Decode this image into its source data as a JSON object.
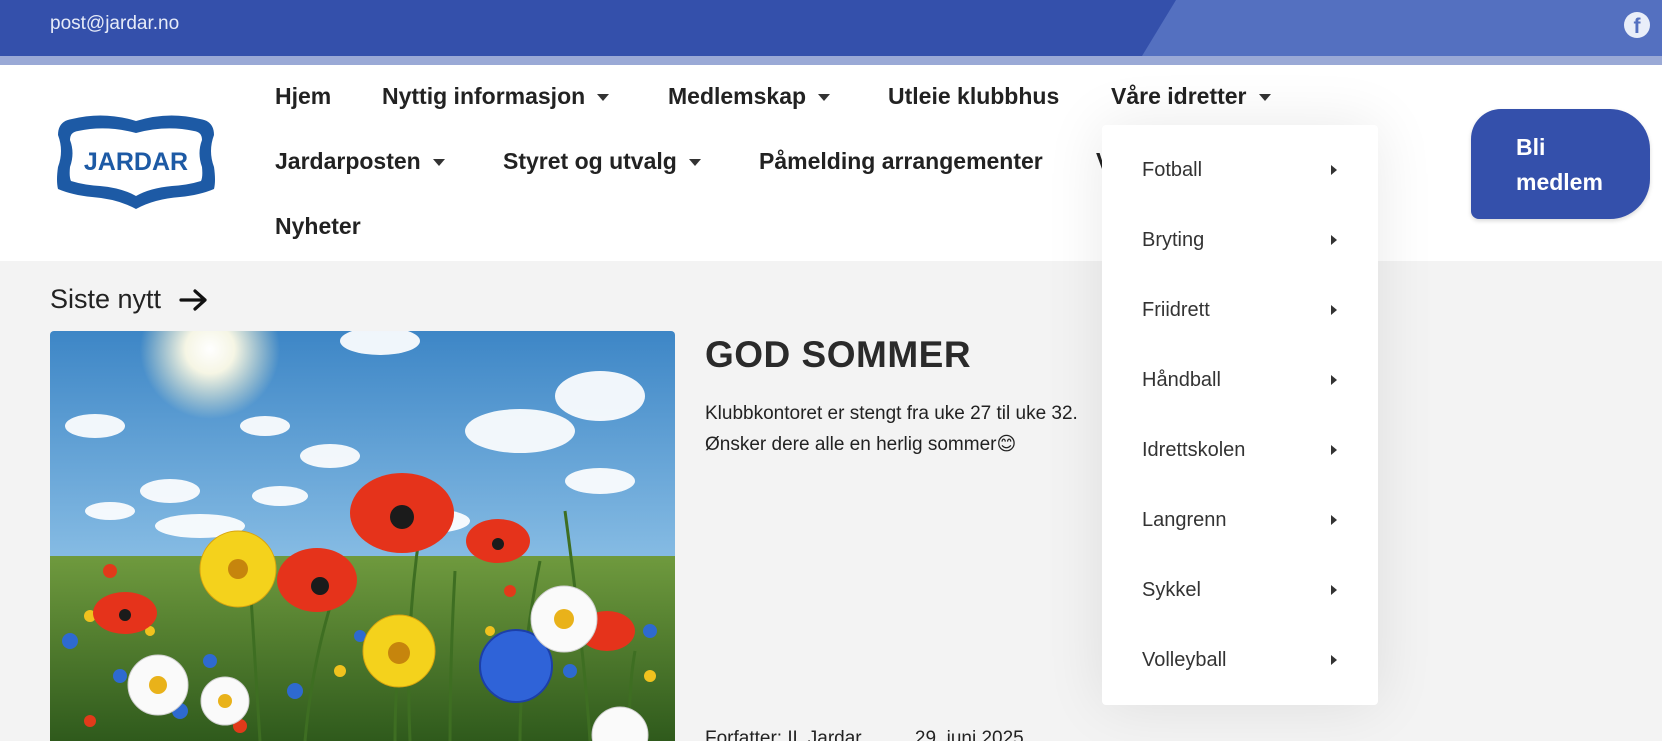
{
  "topbar": {
    "email": "post@jardar.no",
    "social_icon": "facebook-icon"
  },
  "logo": {
    "text": "JARDAR"
  },
  "nav": {
    "items": [
      {
        "label": "Hjem",
        "has_dropdown": false
      },
      {
        "label": "Nyttig informasjon",
        "has_dropdown": true
      },
      {
        "label": "Medlemskap",
        "has_dropdown": true
      },
      {
        "label": "Utleie klubbhus",
        "has_dropdown": false
      },
      {
        "label": "Våre idretter",
        "has_dropdown": true
      },
      {
        "label": "Jardarposten",
        "has_dropdown": true
      },
      {
        "label": "Styret og utvalg",
        "has_dropdown": true
      },
      {
        "label": "Påmelding arrangementer",
        "has_dropdown": false
      },
      {
        "label": "V",
        "has_dropdown": false
      },
      {
        "label": "Nyheter",
        "has_dropdown": false
      }
    ],
    "cta_line1": "Bli",
    "cta_line2": "medlem"
  },
  "dropdown": {
    "open_menu": "Våre idretter",
    "items": [
      "Fotball",
      "Bryting",
      "Friidrett",
      "Håndball",
      "Idrettskolen",
      "Langrenn",
      "Sykkel",
      "Volleyball"
    ]
  },
  "news": {
    "section_title": "Siste nytt",
    "post": {
      "title": "GOD SOMMER",
      "line1": "Klubbkontoret er stengt fra uke 27 til uke 32.",
      "line2": "Ønsker dere alle en herlig sommer😊",
      "author": "Forfatter: IL Jardar",
      "date": "29. juni 2025"
    }
  },
  "colors": {
    "brand_blue": "#3450ab",
    "brand_blue_light": "#5470c0",
    "stripe": "#9aa9d6"
  }
}
